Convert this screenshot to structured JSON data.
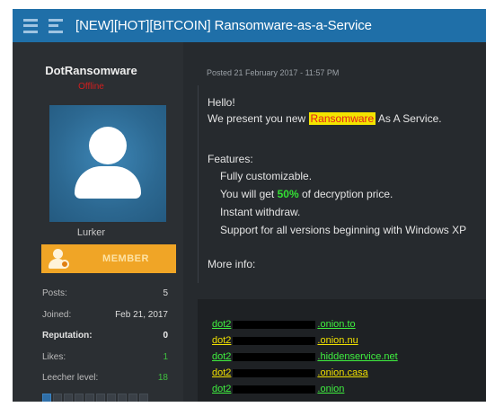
{
  "thread": {
    "title": "[NEW][HOT][BITCOIN] Ransomware-as-a-Service"
  },
  "user": {
    "name": "DotRansomware",
    "status": "Offline",
    "rank": "Lurker",
    "badge": "MEMBER",
    "stats": [
      {
        "key": "Posts:",
        "value": "5"
      },
      {
        "key": "Joined:",
        "value": "Feb 21, 2017"
      },
      {
        "key": "Reputation:",
        "value": "0"
      },
      {
        "key": "Likes:",
        "value": "1"
      },
      {
        "key": "Leecher level:",
        "value": "18"
      }
    ],
    "level_fraction": 0.1
  },
  "post": {
    "date": "Posted 21 February 2017 - 11:57 PM",
    "greeting": "Hello!",
    "intro_before": "We present you new ",
    "intro_highlight": "Ransomware",
    "intro_after": " As A Service.",
    "features_heading": "Features:",
    "feature_1": "Fully customizable.",
    "feature_2_before": "You will get ",
    "feature_2_value": "50%",
    "feature_2_after": " of decryption price.",
    "feature_3": "Instant withdraw.",
    "feature_4": "Support for all versions beginning with Windows XP",
    "more_info": "More info:"
  },
  "links": [
    {
      "prefix": "dot2",
      "suffix": ".onion.to",
      "color": "#3ff03f"
    },
    {
      "prefix": "dot2",
      "suffix": ".onion.nu",
      "color": "#f0e000"
    },
    {
      "prefix": "dot2",
      "suffix": ".hiddenservice.net",
      "color": "#3ff03f"
    },
    {
      "prefix": "dot2",
      "suffix": ".onion.casa",
      "color": "#f0e000"
    },
    {
      "prefix": "dot2",
      "suffix": ".onion",
      "color": "#3ff03f"
    }
  ],
  "colors": {
    "titlebar": "#1f6fa8",
    "badge": "#f0a526",
    "highlight_bg": "#f3e400",
    "highlight_fg": "#e51c1c",
    "link_green": "#3ff03f",
    "link_yellow": "#f0e000"
  }
}
